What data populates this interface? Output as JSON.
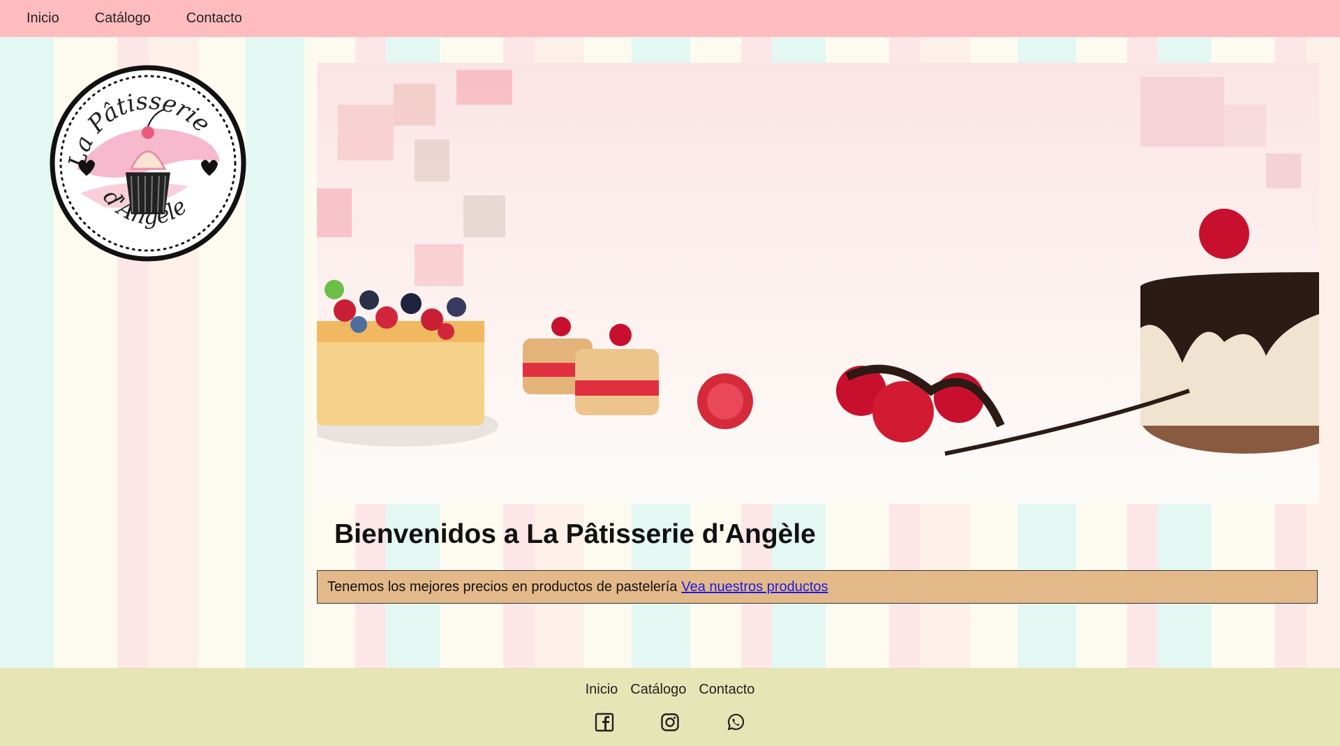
{
  "nav": {
    "items": [
      "Inicio",
      "Catálogo",
      "Contacto"
    ]
  },
  "logo": {
    "line1": "La Pâtisserie",
    "line2": "d'Angèle"
  },
  "welcome_title": "Bienvenidos a La Pâtisserie d'Angèle",
  "promo": {
    "text": "Tenemos los mejores precios en productos de pastelería",
    "link_label": "Vea nuestros productos"
  },
  "footer": {
    "links": [
      "Inicio",
      "Catálogo",
      "Contacto"
    ],
    "social_icons": [
      "facebook-icon",
      "instagram-icon",
      "whatsapp-icon"
    ]
  },
  "colors": {
    "nav_bg": "#ffbcbf",
    "promo_bg": "#e4b98a",
    "footer_bg": "#e6e5b5",
    "link": "#1a1ae0"
  }
}
